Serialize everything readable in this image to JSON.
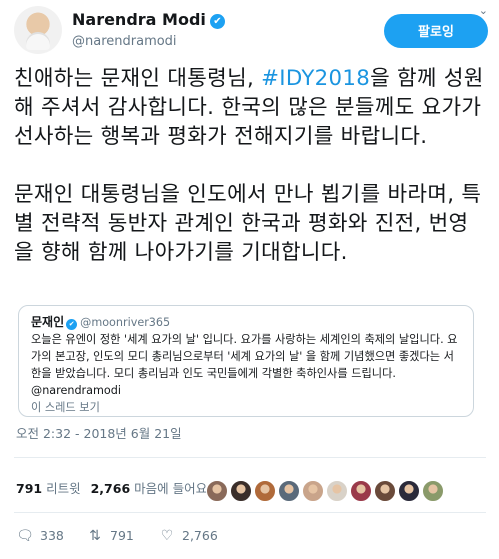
{
  "author": {
    "name": "Narendra Modi",
    "handle": "@narendramodi",
    "verified_icon": "✔"
  },
  "follow_button_label": "팔로잉",
  "tweet": {
    "p1_before": "친애하는 문재인 대통령님, ",
    "hashtag": "#IDY2018",
    "p1_after": "을 함께 성원해 주셔서 감사합니다. 한국의 많은 분들께도 요가가 선사하는 행복과 평화가 전해지기를 바랍니다.",
    "p2": "문재인 대통령님을 인도에서 만나 뵙기를 바라며, 특별 전략적 동반자 관계인 한국과 평화와 진전, 번영을 향해 함께 나아가기를 기대합니다."
  },
  "quote": {
    "name": "문재인",
    "handle": "@moonriver365",
    "text": "오늘은 유엔이 정한 '세계 요가의 날' 입니다. 요가를 사랑하는 세계인의 축제의 날입니다. 요가의 본고장, 인도의 모디 총리님으로부터 '세계 요가의 날' 을 함께 기념했으면 좋겠다는 서한을 받았습니다. 모디 총리님과 인도 국민들에게 각별한 축하인사를 드립니다. @narendramodi",
    "thread_link": "이 스레드 보기"
  },
  "timestamp": "오전 2:32 - 2018년 6월 21일",
  "stats": {
    "retweets_count": "791",
    "retweets_label": "리트윗",
    "likes_count": "2,766",
    "likes_label": "마음에 들어요"
  },
  "actions": {
    "reply_count": "338",
    "retweet_count": "791",
    "like_count": "2,766"
  },
  "liker_avatar_colors": [
    "#8a6a5a",
    "#3a2e2a",
    "#b06a3a",
    "#5a6a7a",
    "#c9a48a",
    "#d9d2c8",
    "#9a3a4a",
    "#6a4a3a",
    "#2a2a3a",
    "#8a9a6a"
  ]
}
